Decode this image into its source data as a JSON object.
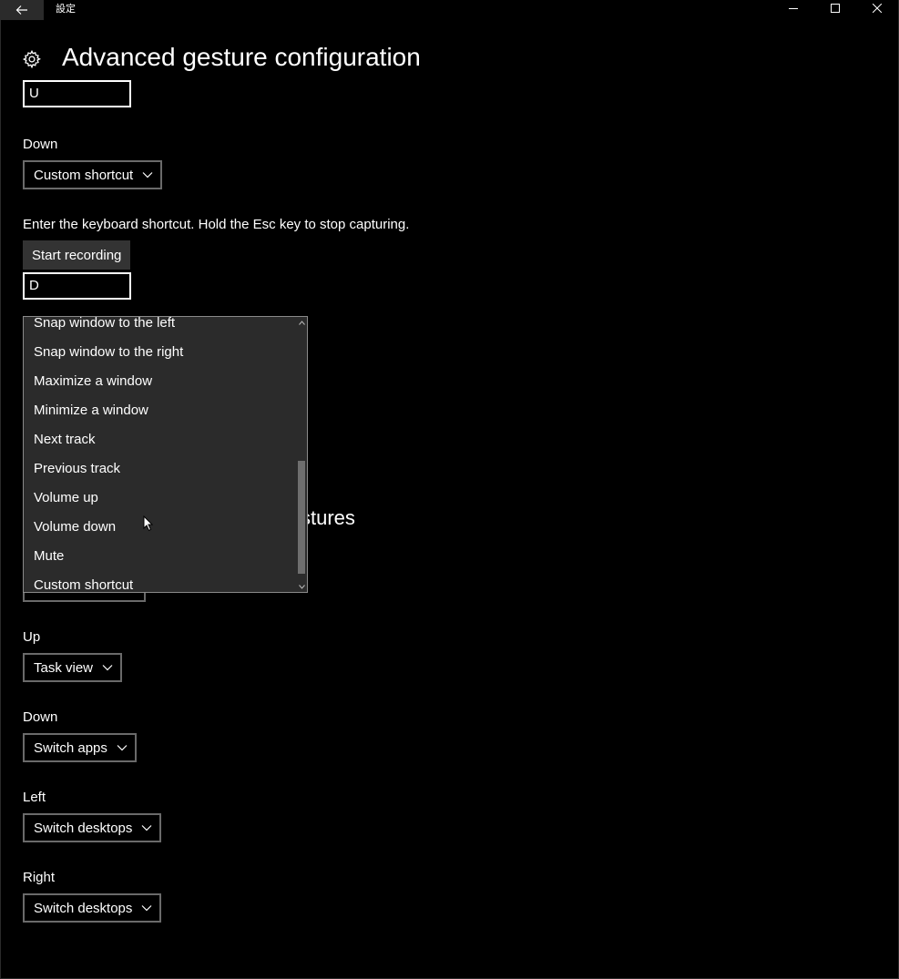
{
  "window": {
    "app_title": "設定",
    "back_icon": "back-arrow-icon",
    "controls": [
      "minimize-icon",
      "maximize-icon",
      "close-icon"
    ]
  },
  "page": {
    "title": "Advanced gesture configuration",
    "icon": "gear-icon"
  },
  "top_input": {
    "value": "U"
  },
  "down_section": {
    "label": "Down",
    "combo_value": "Custom shortcut",
    "instruction": "Enter the keyboard shortcut. Hold the Esc key to stop capturing.",
    "record_button": "Start recording",
    "shortcut_value": "D"
  },
  "dropdown": {
    "items": [
      "Snap window to the left",
      "Snap window to the right",
      "Maximize a window",
      "Minimize a window",
      "Next track",
      "Previous track",
      "Volume up",
      "Volume down",
      "Mute",
      "Custom shortcut"
    ]
  },
  "partial_heading": "stures",
  "four_finger": {
    "up": {
      "label": "Up",
      "value": "Task view"
    },
    "down": {
      "label": "Down",
      "value": "Switch apps"
    },
    "left": {
      "label": "Left",
      "value": "Switch desktops"
    },
    "right": {
      "label": "Right",
      "value": "Switch desktops"
    }
  }
}
